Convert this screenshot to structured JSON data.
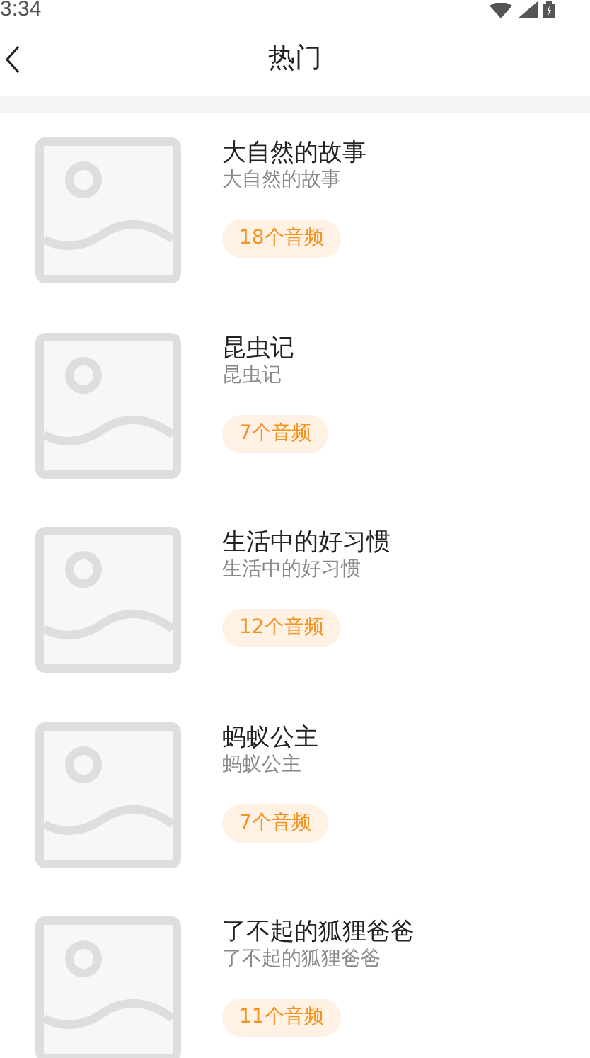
{
  "status_bar": {
    "time": "3:34"
  },
  "header": {
    "title": "热门"
  },
  "items": [
    {
      "title": "大自然的故事",
      "subtitle": "大自然的故事",
      "count": "18个音频"
    },
    {
      "title": "昆虫记",
      "subtitle": "昆虫记",
      "count": "7个音频"
    },
    {
      "title": "生活中的好习惯",
      "subtitle": "生活中的好习惯",
      "count": "12个音频"
    },
    {
      "title": "蚂蚁公主",
      "subtitle": "蚂蚁公主",
      "count": "7个音频"
    },
    {
      "title": "了不起的狐狸爸爸",
      "subtitle": "了不起的狐狸爸爸",
      "count": "11个音频"
    }
  ]
}
